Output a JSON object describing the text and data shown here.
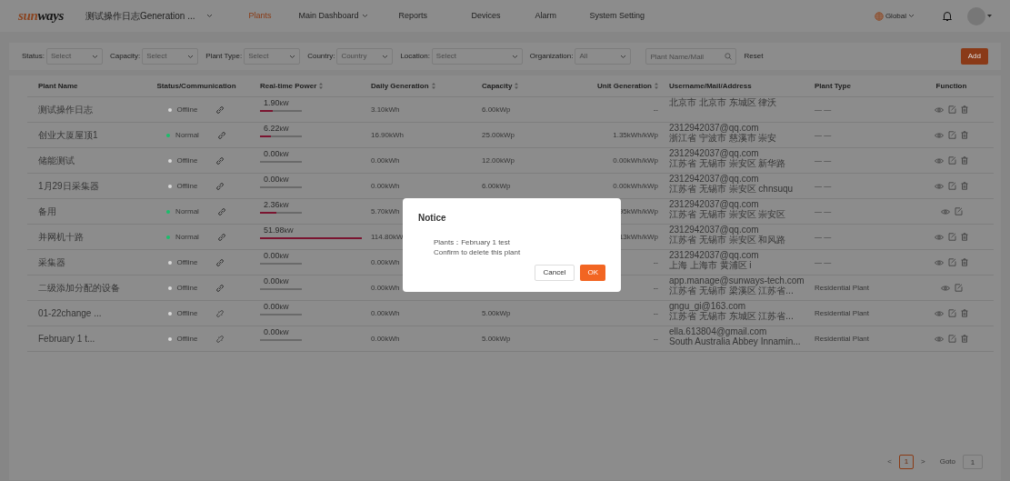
{
  "header": {
    "logo": {
      "part_1": "sun",
      "part_2": "ways"
    },
    "project": "测试操作日志Generation ...",
    "nav": [
      {
        "label": "Plants",
        "selected": true,
        "dropdown": false
      },
      {
        "label": "Main Dashboard",
        "selected": false,
        "dropdown": true
      },
      {
        "label": "Reports",
        "selected": false,
        "dropdown": false
      },
      {
        "label": "Devices",
        "selected": false,
        "dropdown": false
      },
      {
        "label": "Alarm",
        "selected": false,
        "dropdown": false
      },
      {
        "label": "System Setting",
        "selected": false,
        "dropdown": false
      }
    ],
    "region": "Global"
  },
  "filters": [
    {
      "label": "Status:",
      "placeholder": "Select"
    },
    {
      "label": "Capacity:",
      "placeholder": "Select"
    },
    {
      "label": "Plant Type:",
      "placeholder": "Select"
    },
    {
      "label": "Country:",
      "placeholder": "Country"
    },
    {
      "label": "Location:",
      "placeholder": "Select"
    },
    {
      "label": "Organization:",
      "placeholder": "All"
    }
  ],
  "search": {
    "placeholder": "Plant Name/Mail"
  },
  "reset": "Reset",
  "add": "Add",
  "table": {
    "columns": [
      {
        "label": "Plant Name",
        "sortable": false
      },
      {
        "label": "Status/Communication",
        "sortable": false
      },
      {
        "label": "Real-time Power",
        "sortable": true
      },
      {
        "label": "Daily Generation",
        "sortable": true
      },
      {
        "label": "Capacity",
        "sortable": true
      },
      {
        "label": "Unit Generation",
        "sortable": true
      },
      {
        "label": "Username/Mail/Address",
        "sortable": false
      },
      {
        "label": "Plant Type",
        "sortable": false
      },
      {
        "label": "Function",
        "sortable": false
      }
    ],
    "rows": [
      {
        "name": "测试操作日志",
        "status": {
          "text": "Offline",
          "color": "#d9d9d9"
        },
        "linked": true,
        "power": {
          "value": "1.90",
          "unit": "kW",
          "level": 0.3
        },
        "daily": "3.10kWh",
        "capacity": "6.00kWp",
        "unit_gen": "--",
        "user": [
          "北京市 北京市 东城区 律沃"
        ],
        "type": "— —",
        "deletable": true
      },
      {
        "name": "创业大厦屋顶1",
        "status": {
          "text": "Normal",
          "color": "#19be6b"
        },
        "linked": true,
        "power": {
          "value": "6.22",
          "unit": "kW",
          "level": 0.25
        },
        "daily": "16.90kWh",
        "capacity": "25.00kWp",
        "unit_gen": "1.35kWh/kWp",
        "user": [
          "2312942037@qq.com",
          "浙江省 宁波市 慈溪市 崇安"
        ],
        "type": "— —",
        "deletable": true
      },
      {
        "name": "储能测试",
        "status": {
          "text": "Offline",
          "color": "#d9d9d9"
        },
        "linked": true,
        "power": {
          "value": "0.00",
          "unit": "kW",
          "level": 0
        },
        "daily": "0.00kWh",
        "capacity": "12.00kWp",
        "unit_gen": "0.00kWh/kWp",
        "user": [
          "2312942037@qq.com",
          "江苏省 无锡市 崇安区 新华路"
        ],
        "type": "— —",
        "deletable": true
      },
      {
        "name": "1月29日采集器",
        "status": {
          "text": "Offline",
          "color": "#d9d9d9"
        },
        "linked": true,
        "power": {
          "value": "0.00",
          "unit": "kW",
          "level": 0
        },
        "daily": "0.00kWh",
        "capacity": "6.00kWp",
        "unit_gen": "0.00kWh/kWp",
        "user": [
          "2312942037@qq.com",
          "江苏省 无锡市 崇安区 chnsuqu"
        ],
        "type": "— —",
        "deletable": true
      },
      {
        "name": "备用",
        "status": {
          "text": "Normal",
          "color": "#19be6b"
        },
        "linked": true,
        "power": {
          "value": "2.36",
          "unit": "kW",
          "level": 0.4
        },
        "daily": "5.70kWh",
        "unit_gen": "95kWh/kWp",
        "user": [
          "2312942037@qq.com",
          "江苏省 无锡市 崇安区 崇安区"
        ],
        "type": "— —",
        "deletable": false
      },
      {
        "name": "并网机十路",
        "status": {
          "text": "Normal",
          "color": "#19be6b"
        },
        "linked": true,
        "power": {
          "value": "51.98",
          "unit": "kW",
          "level": 1
        },
        "daily": "114.80kW",
        "unit_gen": "13kWh/kWp",
        "user": [
          "2312942037@qq.com",
          "江苏省 无锡市 崇安区 和风路"
        ],
        "type": "— —",
        "deletable": true
      },
      {
        "name": "采集器",
        "status": {
          "text": "Offline",
          "color": "#d9d9d9"
        },
        "linked": true,
        "power": {
          "value": "0.00",
          "unit": "kW",
          "level": 0
        },
        "daily": "0.00kWh",
        "unit_gen": "--",
        "user": [
          "2312942037@qq.com",
          "上海 上海市 黄浦区 i"
        ],
        "type": "— —",
        "deletable": true
      },
      {
        "name": "二级添加分配的设备",
        "status": {
          "text": "Offline",
          "color": "#d9d9d9"
        },
        "linked": true,
        "power": {
          "value": "0.00",
          "unit": "kW",
          "level": 0
        },
        "daily": "0.00kWh",
        "unit_gen": "--",
        "user": [
          "app.manage@sunways-tech.com",
          "江苏省 无锡市 梁溪区 江苏省..."
        ],
        "type": "Residential Plant",
        "deletable": false
      },
      {
        "name": "01-22change ...",
        "status": {
          "text": "Offline",
          "color": "#d9d9d9"
        },
        "linked": false,
        "power": {
          "value": "0.00",
          "unit": "kW",
          "level": 0
        },
        "daily": "0.00kWh",
        "capacity": "5.00kWp",
        "unit_gen": "--",
        "user": [
          "gngu_gi@163.com",
          "江苏省 无锡市 东城区 江苏省..."
        ],
        "type": "Residential Plant",
        "deletable": true
      },
      {
        "name": "February 1 t...",
        "status": {
          "text": "Offline",
          "color": "#d9d9d9"
        },
        "linked": false,
        "power": {
          "value": "0.00",
          "unit": "kW",
          "level": 0
        },
        "daily": "0.00kWh",
        "capacity": "5.00kWp",
        "unit_gen": "--",
        "user": [
          "ella.613804@gmail.com",
          "South Australia Abbey Innamin..."
        ],
        "type": "Residential Plant",
        "deletable": true
      }
    ]
  },
  "pagination": {
    "prev": "<",
    "pages": [
      {
        "label": "1",
        "selected": true
      }
    ],
    "next": ">",
    "goto": "Goto",
    "goto_value": "1"
  },
  "dialog": {
    "title": "Notice",
    "lines": [
      "Plants：February 1 test",
      "Confirm to delete this plant"
    ],
    "cancel": "Cancel",
    "ok": "OK"
  }
}
